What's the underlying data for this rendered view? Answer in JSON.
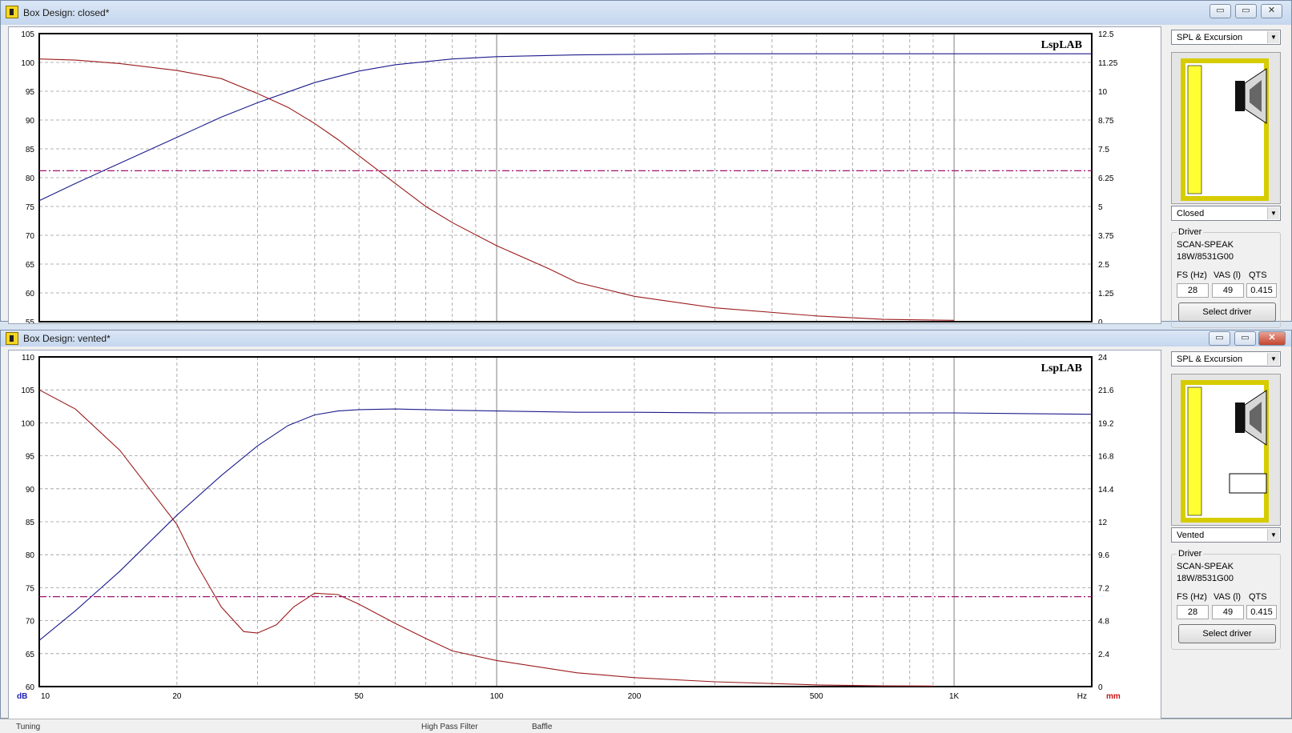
{
  "windows": [
    {
      "title": "Box Design: closed*",
      "logo": "LspLAB",
      "graph_mode": "SPL & Excursion",
      "box_type": "Closed",
      "driver": {
        "group_label": "Driver",
        "brand": "SCAN-SPEAK",
        "model": "18W/8531G00",
        "fs_label": "FS (Hz)",
        "vas_label": "VAS (l)",
        "qts_label": "QTS",
        "fs": "28",
        "vas": "49",
        "qts": "0.415"
      },
      "select_driver_label": "Select driver",
      "buttons": {
        "minimize": "▭",
        "restore": "▭",
        "close": "✕"
      }
    },
    {
      "title": "Box Design: vented*",
      "logo": "LspLAB",
      "graph_mode": "SPL & Excursion",
      "box_type": "Vented",
      "driver": {
        "group_label": "Driver",
        "brand": "SCAN-SPEAK",
        "model": "18W/8531G00",
        "fs_label": "FS (Hz)",
        "vas_label": "VAS (l)",
        "qts_label": "QTS",
        "fs": "28",
        "vas": "49",
        "qts": "0.415"
      },
      "select_driver_label": "Select driver",
      "buttons": {
        "minimize": "▭",
        "restore": "▭",
        "close": "✕"
      }
    }
  ],
  "bottom_tabs": [
    "Tuning",
    "High Pass Filter",
    "Baffle"
  ],
  "colors": {
    "spl": "#1c1c8c",
    "excursion": "#9b1b1b",
    "xmax": "#a0146e",
    "grid": "#9a9a9a"
  },
  "chart_data": [
    {
      "type": "line",
      "x_scale": "log",
      "xlim": [
        10,
        2000
      ],
      "ylim": [
        55,
        105
      ],
      "y2lim": [
        0,
        12.5
      ],
      "y_ticks": [
        "105",
        "100",
        "95",
        "90",
        "85",
        "80",
        "75",
        "70",
        "65",
        "60",
        "55"
      ],
      "y2_ticks": [
        "12.5",
        "11.25",
        "10",
        "8.75",
        "7.5",
        "6.25",
        "5",
        "3.75",
        "2.5",
        "1.25",
        "0"
      ],
      "x_ticks": [],
      "series": [
        {
          "axis": "y",
          "x": [
            10,
            12,
            15,
            20,
            25,
            30,
            40,
            50,
            60,
            80,
            100,
            150,
            200,
            300,
            500,
            1000,
            2000
          ],
          "values": [
            76,
            79,
            82.5,
            87,
            90.5,
            93,
            96.5,
            98.5,
            99.6,
            100.6,
            101,
            101.3,
            101.4,
            101.5,
            101.5,
            101.5,
            101.5
          ]
        },
        {
          "axis": "y2",
          "x": [
            10,
            12,
            15,
            20,
            25,
            30,
            35,
            40,
            45,
            50,
            60,
            70,
            80,
            100,
            130,
            150,
            200,
            300,
            500,
            700,
            1000
          ],
          "values": [
            11.4,
            11.35,
            11.2,
            10.9,
            10.55,
            9.9,
            9.3,
            8.6,
            7.9,
            7.2,
            6.0,
            5.0,
            4.3,
            3.3,
            2.3,
            1.7,
            1.1,
            0.6,
            0.25,
            0.1,
            0.06
          ]
        },
        {
          "axis": "y2",
          "x": [
            10,
            2000
          ],
          "values": [
            6.55,
            6.55
          ]
        }
      ]
    },
    {
      "type": "line",
      "x_scale": "log",
      "xlim": [
        10,
        2000
      ],
      "ylim": [
        60,
        110
      ],
      "y2lim": [
        0,
        24
      ],
      "y_ticks": [
        "110",
        "105",
        "100",
        "95",
        "90",
        "85",
        "80",
        "75",
        "70",
        "65",
        "60"
      ],
      "y2_ticks": [
        "24",
        "21.6",
        "19.2",
        "16.8",
        "14.4",
        "12",
        "9.6",
        "7.2",
        "4.8",
        "2.4",
        "0"
      ],
      "x_ticks": [
        "10",
        "20",
        "50",
        "100",
        "200",
        "500",
        "1K",
        "Hz"
      ],
      "y_unit": "dB",
      "y2_unit": "mm",
      "series": [
        {
          "axis": "y",
          "x": [
            10,
            12,
            15,
            20,
            25,
            30,
            35,
            40,
            45,
            50,
            60,
            70,
            80,
            100,
            150,
            200,
            300,
            500,
            1000,
            2000
          ],
          "values": [
            67,
            71.5,
            77.5,
            86,
            92,
            96.5,
            99.6,
            101.2,
            101.8,
            102,
            102.1,
            102,
            101.9,
            101.8,
            101.6,
            101.6,
            101.5,
            101.5,
            101.5,
            101.3
          ]
        },
        {
          "axis": "y2",
          "x": [
            10,
            12,
            15,
            20,
            22,
            25,
            28,
            30,
            33,
            36,
            40,
            45,
            50,
            60,
            70,
            80,
            100,
            150,
            200,
            300,
            500,
            700,
            900
          ],
          "values": [
            21.6,
            20.2,
            17.2,
            11.8,
            9.0,
            5.8,
            4.0,
            3.9,
            4.5,
            5.8,
            6.8,
            6.7,
            6.0,
            4.6,
            3.5,
            2.6,
            1.9,
            1.0,
            0.65,
            0.35,
            0.12,
            0.05,
            0.04
          ]
        },
        {
          "axis": "y2",
          "x": [
            10,
            2000
          ],
          "values": [
            6.55,
            6.55
          ]
        }
      ]
    }
  ]
}
